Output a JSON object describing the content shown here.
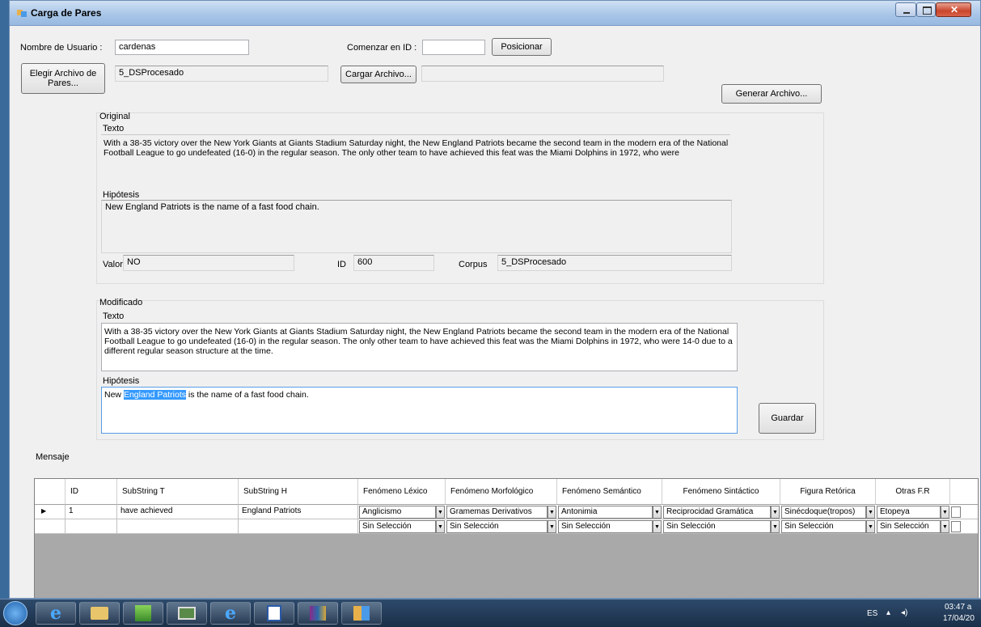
{
  "window": {
    "title": "Carga de Pares"
  },
  "top": {
    "user_label": "Nombre de Usuario :",
    "user_value": "cardenas",
    "start_id_label": "Comenzar en ID :",
    "start_id_value": "",
    "position_button": "Posicionar",
    "choose_file_button": "Elegir Archivo de Pares...",
    "file_value": "5_DSProcesado",
    "load_file_button": "Cargar Archivo...",
    "load_file_value": "",
    "generate_file_button": "Generar Archivo..."
  },
  "original": {
    "group_label": "Original",
    "text_label": "Texto",
    "text_value": "With a 38-35 victory over the New York Giants at Giants Stadium Saturday night, the New England Patriots became the second team in the modern era of the National Football League to go undefeated (16-0) in the regular season. The only other team to have achieved this feat was the Miami Dolphins in 1972, who were",
    "hypothesis_label": "Hipótesis",
    "hypothesis_value": "New England Patriots is the name of a fast food chain.",
    "valor_label": "Valor",
    "valor_value": "NO",
    "id_label": "ID",
    "id_value": "600",
    "corpus_label": "Corpus",
    "corpus_value": "5_DSProcesado"
  },
  "modified": {
    "group_label": "Modificado",
    "text_label": "Texto",
    "text_value": "With a 38-35 victory over the New York Giants at Giants Stadium Saturday night, the New England Patriots became the second team in the modern era of the National Football League to go undefeated (16-0) in the regular season. The only other team to have achieved this feat was the Miami Dolphins in 1972, who were 14-0 due to a different regular season structure at the time.",
    "hypothesis_label": "Hipótesis",
    "hypothesis_before": "New ",
    "hypothesis_selected": "England Patriots",
    "hypothesis_after": " is the name of a fast food chain.",
    "save_button": "Guardar"
  },
  "message_label": "Mensaje",
  "grid": {
    "headers": {
      "id": "ID",
      "substring_t": "SubString T",
      "substring_h": "SubString H",
      "lexico": "Fenómeno Léxico",
      "morfologico": "Fenómeno Morfológico",
      "semantico": "Fenómeno Semántico",
      "sintactico": "Fenómeno Sintáctico",
      "retorica": "Figura Retórica",
      "otras": "Otras F.R"
    },
    "row1": {
      "id": "1",
      "substring_t": "have achieved",
      "substring_h": "England Patriots",
      "lexico": "Anglicismo",
      "morfologico": "Gramemas Derivativos",
      "semantico": "Antonimia",
      "sintactico": "Reciprocidad Gramática",
      "retorica": "Sinécdoque(tropos)",
      "otras": "Etopeya"
    },
    "row2": {
      "lexico": "Sin Selección",
      "morfologico": "Sin Selección",
      "semantico": "Sin Selección",
      "sintactico": "Sin Selección",
      "retorica": "Sin Selección",
      "otras": "Sin Selección"
    }
  },
  "taskbar": {
    "lang": "ES",
    "time": "03:47 a",
    "date": "17/04/20"
  },
  "colors": {
    "selection": "#3399ff",
    "taskbar": "#1b2f47"
  }
}
